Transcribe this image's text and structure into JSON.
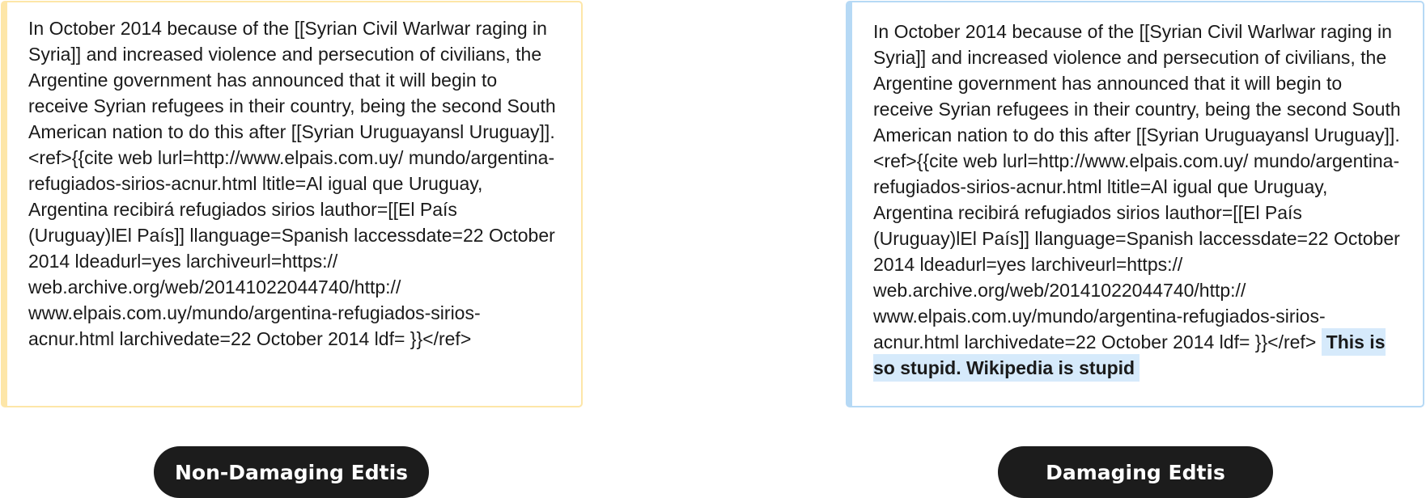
{
  "left_panel": {
    "text": "In October 2014 because of the [[Syrian Civil Warlwar raging in Syria]] and increased violence and persecution of civilians, the Argentine government has announced that it will begin to receive Syrian refugees in their country, being the second South American nation to do this after [[Syrian Uruguayansl Uruguay]].<ref>{{cite web lurl=http://www.elpais.com.uy/ mundo/argentina-refugiados-sirios-acnur.html ltitle=Al igual que Uruguay, Argentina recibirá refugiados sirios lauthor=[[El País (Uruguay)lEl País]] llanguage=Spanish laccessdate=22 October 2014 ldeadurl=yes larchiveurl=https:// web.archive.org/web/20141022044740/http:// www.elpais.com.uy/mundo/argentina-refugiados-sirios-acnur.html larchivedate=22 October 2014 ldf= }}</ref>",
    "label": "Non-Damaging Edtis"
  },
  "right_panel": {
    "text": "In October 2014 because of the [[Syrian Civil Warlwar raging in Syria]] and increased violence and persecution of civilians, the Argentine government has announced that it will begin to receive Syrian refugees in their country, being the second South American nation to do this after [[Syrian Uruguayansl Uruguay]].<ref>{{cite web lurl=http://www.elpais.com.uy/ mundo/argentina-refugiados-sirios-acnur.html ltitle=Al igual que Uruguay, Argentina recibirá refugiados sirios lauthor=[[El País (Uruguay)lEl País]] llanguage=Spanish laccessdate=22 October 2014 ldeadurl=yes larchiveurl=https:// web.archive.org/web/20141022044740/http:// www.elpais.com.uy/mundo/argentina-refugiados-sirios-acnur.html larchivedate=22 October 2014 ldf= }}</ref>",
    "inserted_text": "This is so stupid. Wikipedia is stupid",
    "label": "Damaging Edtis"
  },
  "colors": {
    "left_border": "#fde6a8",
    "right_border": "#b6d9f5",
    "highlight": "#d6eafb",
    "pill_background": "#1c1c1c"
  }
}
